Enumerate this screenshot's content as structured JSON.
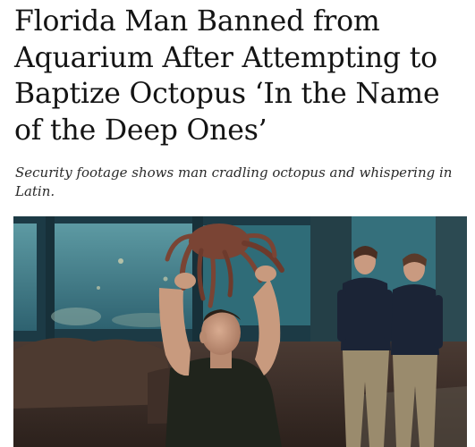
{
  "article": {
    "headline_lines": [
      "Florida Man Banned from",
      "Aquarium After Attempting to",
      "Baptize Octopus ‘In the Name",
      "of the Deep Ones’"
    ],
    "deck": "Security footage shows man cradling octopus and whispering in Latin."
  },
  "photo": {
    "subject": "man holding octopus overhead in aquarium, two staff walking behind",
    "colors": {
      "tank_water": "#3f7f8a",
      "wall": "#1c3a45",
      "floor": "#3a2c26",
      "shirt": "#20241c",
      "skin": "#c89a7e",
      "octopus": "#7a4434",
      "staff_shirt": "#1b2436",
      "staff_pants": "#9a8b6d"
    }
  }
}
